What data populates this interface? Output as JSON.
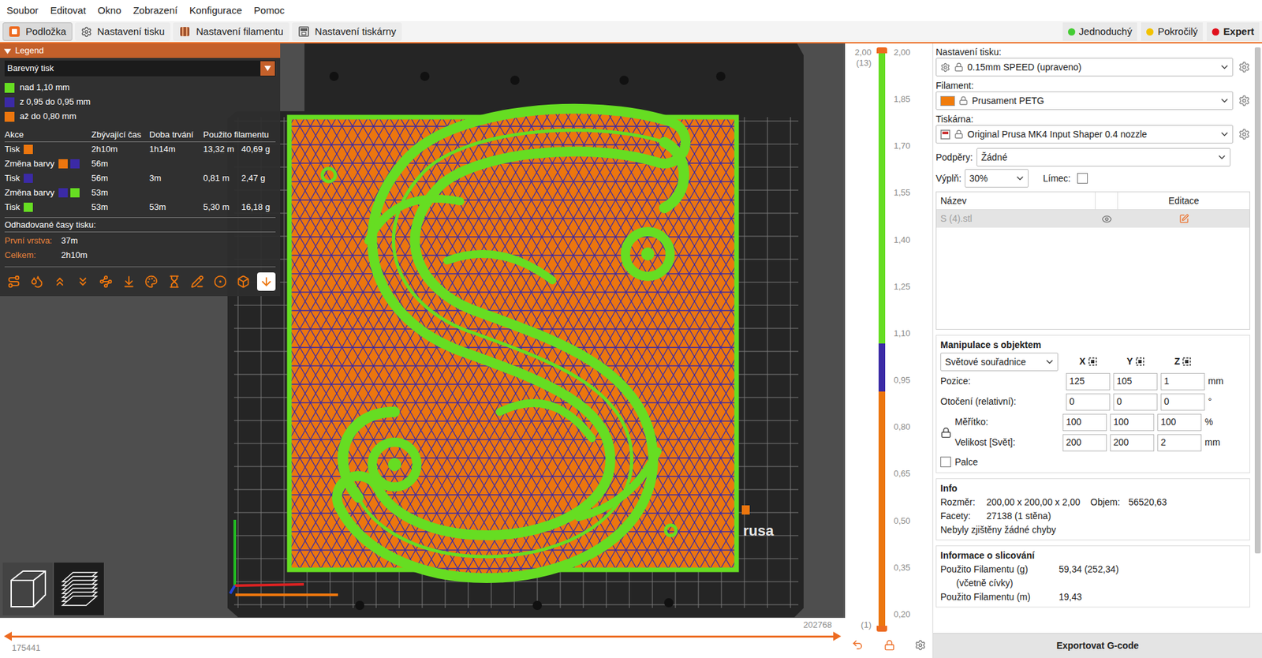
{
  "menu": [
    "Soubor",
    "Editovat",
    "Okno",
    "Zobrazení",
    "Konfigurace",
    "Pomoc"
  ],
  "tabs": [
    {
      "label": "Podložka",
      "kind": "plater",
      "selected": true
    },
    {
      "label": "Nastavení tisku",
      "kind": "print",
      "selected": false
    },
    {
      "label": "Nastavení filamentu",
      "kind": "filament",
      "selected": false
    },
    {
      "label": "Nastavení tiskárny",
      "kind": "printer",
      "selected": false
    }
  ],
  "modes": [
    {
      "label": "Jednoduchý",
      "color": "#44cc33",
      "selected": false
    },
    {
      "label": "Pokročilý",
      "color": "#f2c200",
      "selected": false
    },
    {
      "label": "Expert",
      "color": "#e0101c",
      "selected": true
    }
  ],
  "legend": {
    "title": "Legend",
    "expanded": true,
    "view_select": "Barevný tisk",
    "ranges": [
      {
        "label": "nad 1,10 mm",
        "color": "#66dd22"
      },
      {
        "label": "z 0,95 do 0,95 mm",
        "color": "#3b2aa6"
      },
      {
        "label": "až do 0,80 mm",
        "color": "#ec760e"
      }
    ],
    "columns": [
      "Akce",
      "Zbývající čas",
      "Doba trvání",
      "Použito filamentu"
    ],
    "rows": [
      {
        "action": "Tisk",
        "colors": [
          "#ec760e"
        ],
        "remaining": "2h10m",
        "duration": "1h14m",
        "length": "13,32 m",
        "weight": "40,69 g"
      },
      {
        "action": "Změna barvy",
        "colors": [
          "#ec760e",
          "#3b2aa6"
        ],
        "remaining": "56m",
        "duration": "",
        "length": "",
        "weight": ""
      },
      {
        "action": "Tisk",
        "colors": [
          "#3b2aa6"
        ],
        "remaining": "56m",
        "duration": "3m",
        "length": "0,81 m",
        "weight": "2,47 g"
      },
      {
        "action": "Změna barvy",
        "colors": [
          "#3b2aa6",
          "#66dd22"
        ],
        "remaining": "53m",
        "duration": "",
        "length": "",
        "weight": ""
      },
      {
        "action": "Tisk",
        "colors": [
          "#66dd22"
        ],
        "remaining": "53m",
        "duration": "53m",
        "length": "5,30 m",
        "weight": "16,18 g"
      }
    ],
    "estimated_title": "Odhadované časy tisku:",
    "times": [
      {
        "label": "První vrstva:",
        "value": "37m"
      },
      {
        "label": "Celkem:",
        "value": "2h10m"
      }
    ],
    "tools": [
      {
        "kind": "travel",
        "selected": false
      },
      {
        "kind": "wipe",
        "selected": false
      },
      {
        "kind": "retractions",
        "selected": false
      },
      {
        "kind": "deretractions",
        "selected": false
      },
      {
        "kind": "seams",
        "selected": false
      },
      {
        "kind": "tool-changes",
        "selected": false
      },
      {
        "kind": "color-changes",
        "selected": false
      },
      {
        "kind": "pause",
        "selected": false
      },
      {
        "kind": "custom-gcode",
        "selected": false
      },
      {
        "kind": "center-of-gravity",
        "selected": false
      },
      {
        "kind": "shells",
        "selected": false
      },
      {
        "kind": "tool-marker",
        "selected": true
      }
    ]
  },
  "view_buttons": [
    {
      "kind": "3d",
      "selected": false
    },
    {
      "kind": "preview",
      "selected": true
    }
  ],
  "bed": {
    "logo": "rusa"
  },
  "layer_slider": {
    "top_value": "2,00",
    "top_layer": "(13)",
    "bottom_layer": "(1)",
    "ticks": [
      "2,00",
      "1,85",
      "1,70",
      "1,55",
      "1,40",
      "1,25",
      "1,10",
      "0,95",
      "0,80",
      "0,65",
      "0,50",
      "0,35",
      "0,20"
    ],
    "segments": [
      {
        "color": "#66dd22",
        "level": 0.507
      },
      {
        "color": "#3b2aa6",
        "level": 0.084
      },
      {
        "color": "#ec760e",
        "level": 0.409
      }
    ]
  },
  "move_slider": {
    "start": "175441",
    "end": "202768",
    "level": 1
  },
  "profiles": [
    {
      "label": "Nastavení tisku:",
      "value": "0.15mm SPEED (upraveno)",
      "kind": "print"
    },
    {
      "label": "Filament:",
      "value": "Prusament PETG",
      "kind": "filament",
      "color": "#f07c0c"
    },
    {
      "label": "Tiskárna:",
      "value": "Original Prusa MK4 Input Shaper 0.4 nozzle",
      "kind": "printer"
    }
  ],
  "supports": {
    "label": "Podpěry:",
    "value": "Žádné"
  },
  "infill": {
    "label": "Výplň:",
    "value": "30%"
  },
  "brim": {
    "label": "Límec:",
    "checked": false
  },
  "object_list": {
    "columns": [
      "Název",
      "Editace"
    ],
    "rows": [
      {
        "name": "S (4).stl",
        "selected": true,
        "visible": true
      }
    ]
  },
  "manipulation": {
    "title": "Manipulace s objektem",
    "coordinates": "Světové souřadnice",
    "axes": [
      "X",
      "Y",
      "Z"
    ],
    "rows": [
      {
        "label": "Pozice:",
        "values": [
          "125",
          "105",
          "1"
        ],
        "unit": "mm",
        "group": "none"
      },
      {
        "label": "Otočení (relativní):",
        "values": [
          "0",
          "0",
          "0"
        ],
        "unit": "°",
        "group": "none"
      },
      {
        "label": "Měřítko:",
        "values": [
          "100",
          "100",
          "100"
        ],
        "unit": "%",
        "group": "scale"
      },
      {
        "label": "Velikost [Svět]:",
        "values": [
          "200",
          "200",
          "2"
        ],
        "unit": "mm",
        "group": "scale"
      }
    ],
    "scale_locked": true,
    "inches": {
      "label": "Palce",
      "checked": false
    }
  },
  "info": {
    "title": "Info",
    "size": {
      "label": "Rozměr:",
      "value": "200,00 x 200,00 x 2,00"
    },
    "volume": {
      "label": "Objem:",
      "value": "56520,63"
    },
    "facets": {
      "label": "Facety:",
      "value": "27138 (1 stěna)"
    },
    "status": "Nebyly zjištěny žádné chyby"
  },
  "slicing": {
    "title": "Informace o slicování",
    "rows": [
      {
        "label": "Použito Filamentu (g)",
        "sublabel": "(včetně cívky)",
        "value": "59,34 (252,34)"
      },
      {
        "label": "Použito Filamentu (m)",
        "sublabel": "",
        "value": "19,43"
      }
    ]
  },
  "scrollbar": {
    "level": 0.87
  },
  "export_button": "Exportovat G-code"
}
